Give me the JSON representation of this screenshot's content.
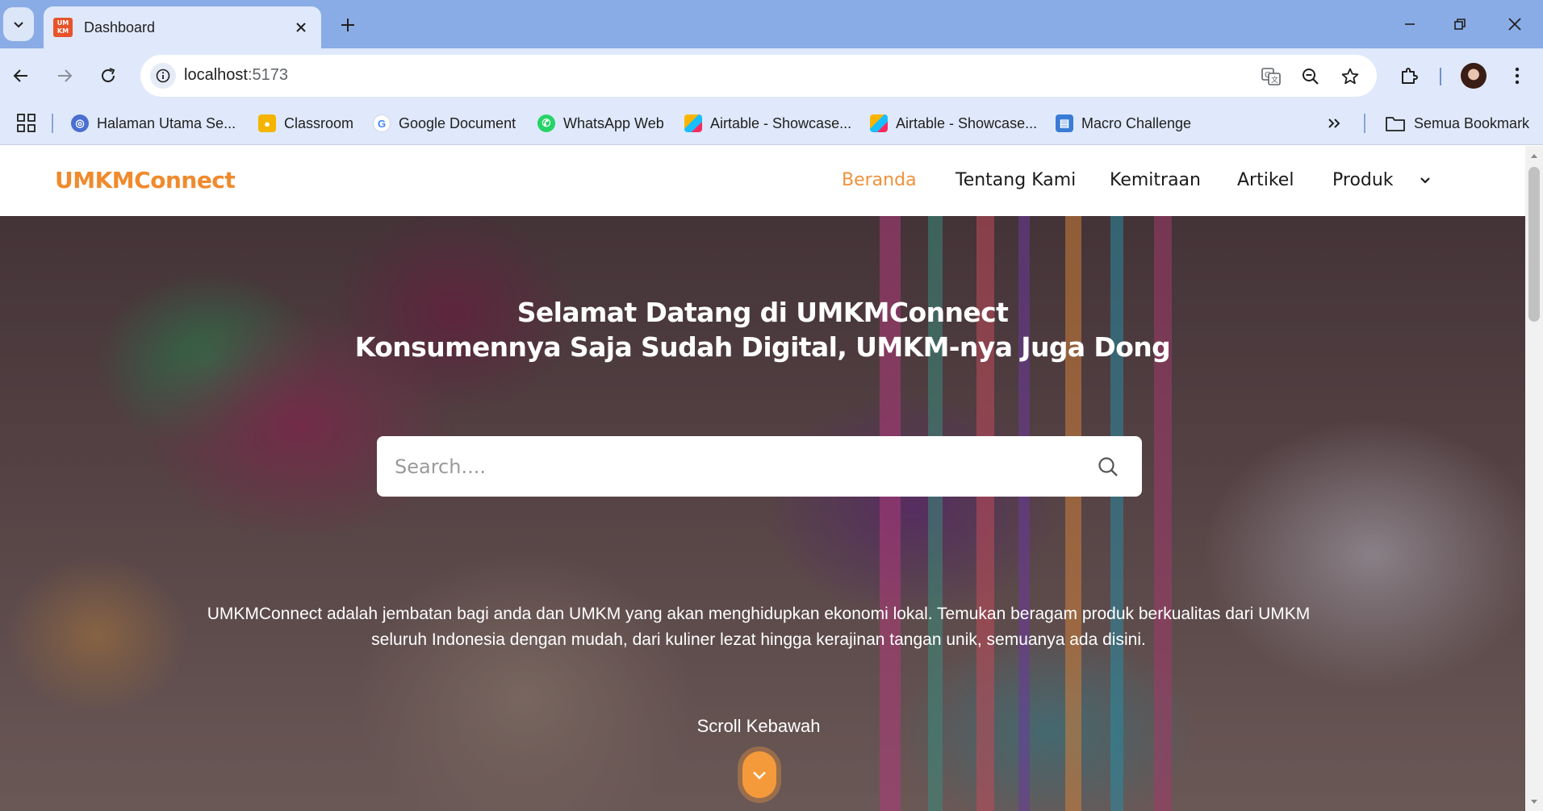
{
  "browser": {
    "tab": {
      "title": "Dashboard",
      "favicon_text": "UMKM"
    },
    "address": {
      "host": "localhost",
      "port": ":5173"
    },
    "bookmarks": [
      {
        "label": "Halaman Utama Se...",
        "icon": "halaman-icon",
        "color": "#4a6fd1"
      },
      {
        "label": "Classroom",
        "icon": "classroom-icon",
        "color": "#f4b400"
      },
      {
        "label": "Google Document",
        "icon": "google-icon",
        "color": "#4285f4"
      },
      {
        "label": "WhatsApp Web",
        "icon": "whatsapp-icon",
        "color": "#25d366"
      },
      {
        "label": "Airtable - Showcase...",
        "icon": "airtable-icon",
        "color": "#fcb400"
      },
      {
        "label": "Airtable - Showcase...",
        "icon": "airtable-icon",
        "color": "#fcb400"
      },
      {
        "label": "Macro Challenge",
        "icon": "notebook-icon",
        "color": "#3a7bd5"
      }
    ],
    "all_bookmarks_label": "Semua Bookmark"
  },
  "site": {
    "logo": "UMKMConnect",
    "nav": [
      {
        "label": "Beranda",
        "active": true
      },
      {
        "label": "Tentang Kami",
        "active": false
      },
      {
        "label": "Kemitraan",
        "active": false
      },
      {
        "label": "Artikel",
        "active": false
      },
      {
        "label": "Produk",
        "active": false
      }
    ],
    "accent_color": "#f08a2c"
  },
  "hero": {
    "title_line1": "Selamat Datang di UMKMConnect",
    "title_line2": "Konsumennya Saja Sudah Digital, UMKM-nya Juga Dong",
    "search_placeholder": "Search....",
    "description": "UMKMConnect adalah jembatan bagi anda dan UMKM yang akan menghidupkan ekonomi lokal. Temukan beragam produk berkualitas dari UMKM seluruh Indonesia dengan mudah, dari kuliner lezat hingga kerajinan tangan unik, semuanya ada disini.",
    "scroll_label": "Scroll Kebawah"
  }
}
